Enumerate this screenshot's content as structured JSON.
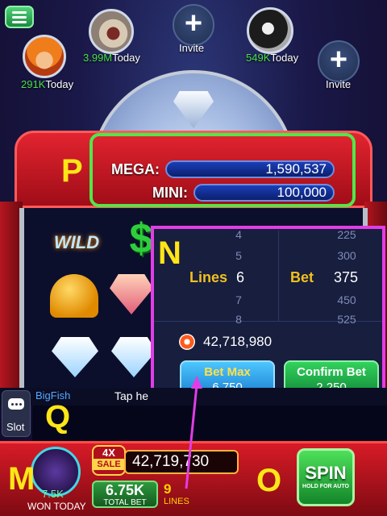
{
  "top": {
    "friends": [
      {
        "score": "291K",
        "suffix": "Today"
      },
      {
        "score": "3.99M",
        "suffix": "Today"
      },
      {
        "score": "549K",
        "suffix": "Today"
      }
    ],
    "invite_label": "Invite"
  },
  "jackpot": {
    "mega_label": "MEGA:",
    "mega_value": "1,590,537",
    "mini_label": "MINI:",
    "mini_value": "100,000"
  },
  "reel_symbols": [
    "wild",
    "dollar",
    "bell",
    "ruby",
    "diamond",
    "diamond"
  ],
  "reel_text": {
    "wild": "WILD",
    "dollar": "$"
  },
  "bet_panel": {
    "lines_label": "Lines",
    "bet_label": "Bet",
    "lines_options": [
      "4",
      "5",
      "6",
      "7",
      "8"
    ],
    "lines_selected": "6",
    "bet_options": [
      "225",
      "300",
      "375",
      "450",
      "525"
    ],
    "bet_selected": "375",
    "coins": "42,718,980",
    "bet_max_label": "Bet Max",
    "bet_max_value": "6,750",
    "confirm_label": "Confirm Bet",
    "confirm_value": "2,250"
  },
  "chat": {
    "sender": "BigFish",
    "message": "Tap he",
    "slot_label": "Slot"
  },
  "bottom": {
    "won_value": "7.5K",
    "won_label": "WON TODAY",
    "sale_multiplier": "4X",
    "sale_label": "SALE",
    "balance": "42,719,730",
    "total_bet": "6.75K",
    "total_bet_label": "TOTAL BET",
    "lines_count": "9",
    "lines_label": "LINES",
    "spin_label": "SPIN",
    "spin_hint": "HOLD FOR AUTO"
  },
  "annotations": {
    "p": "P",
    "n": "N",
    "q": "Q",
    "m": "M",
    "o": "O"
  },
  "colors": {
    "annotation_yellow": "#ffe617",
    "highlight_green": "#4ee84a",
    "highlight_magenta": "#e13de6",
    "arrow_magenta": "#e13de6"
  }
}
